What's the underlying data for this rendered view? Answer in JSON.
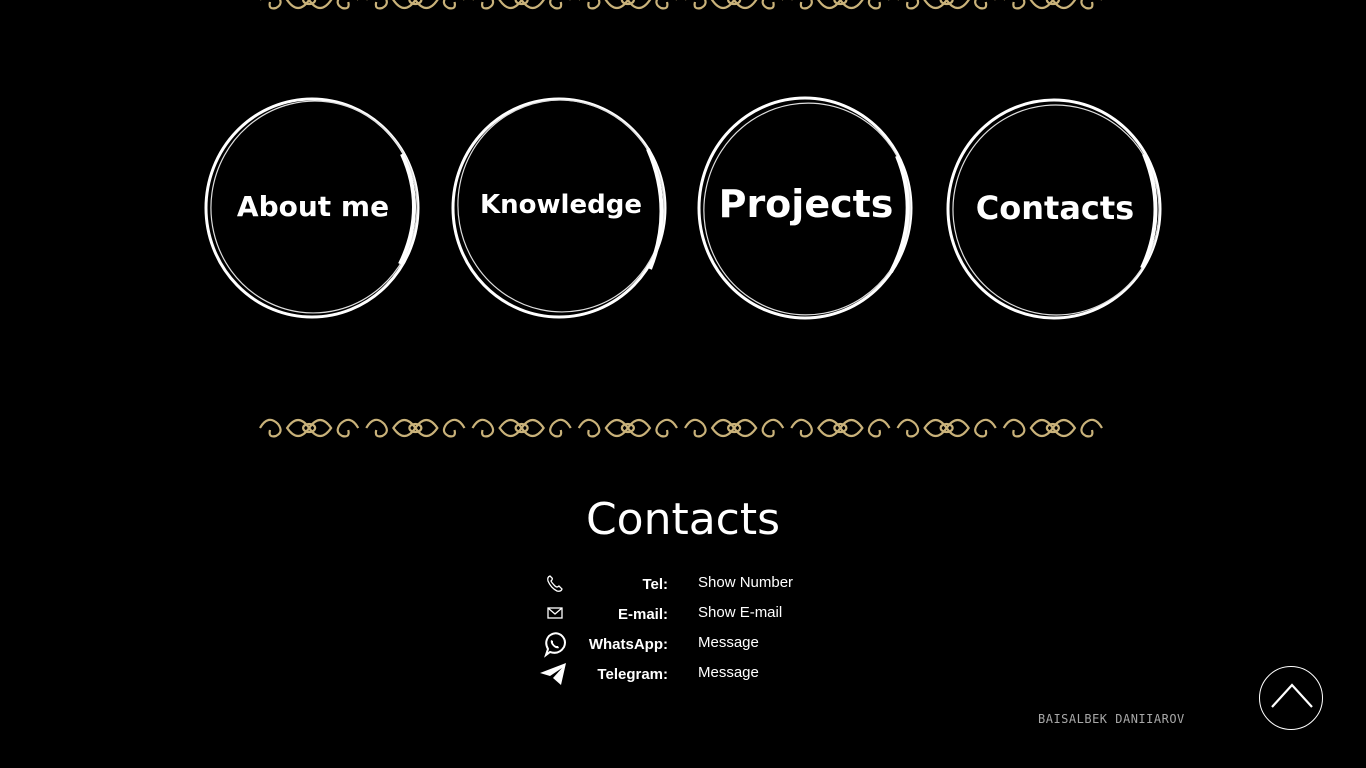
{
  "nav": {
    "items": [
      {
        "label": "About me"
      },
      {
        "label": "Knowledge"
      },
      {
        "label": "Projects"
      },
      {
        "label": "Contacts"
      }
    ]
  },
  "contacts": {
    "title": "Contacts",
    "rows": [
      {
        "icon": "phone-icon",
        "label": "Tel:",
        "value": "Show Number"
      },
      {
        "icon": "mail-icon",
        "label": "E-mail:",
        "value": "Show E-mail"
      },
      {
        "icon": "whatsapp-icon",
        "label": "WhatsApp:",
        "value": "Message"
      },
      {
        "icon": "telegram-icon",
        "label": "Telegram:",
        "value": "Message"
      }
    ]
  },
  "footer": {
    "signature": "BAISALBEK DANIIAROV",
    "scroll_top_icon": "chevron-up-icon"
  },
  "colors": {
    "background": "#000000",
    "ornament_gold": "#c9b27a",
    "text": "#ffffff",
    "signature": "#a8a8a8"
  }
}
